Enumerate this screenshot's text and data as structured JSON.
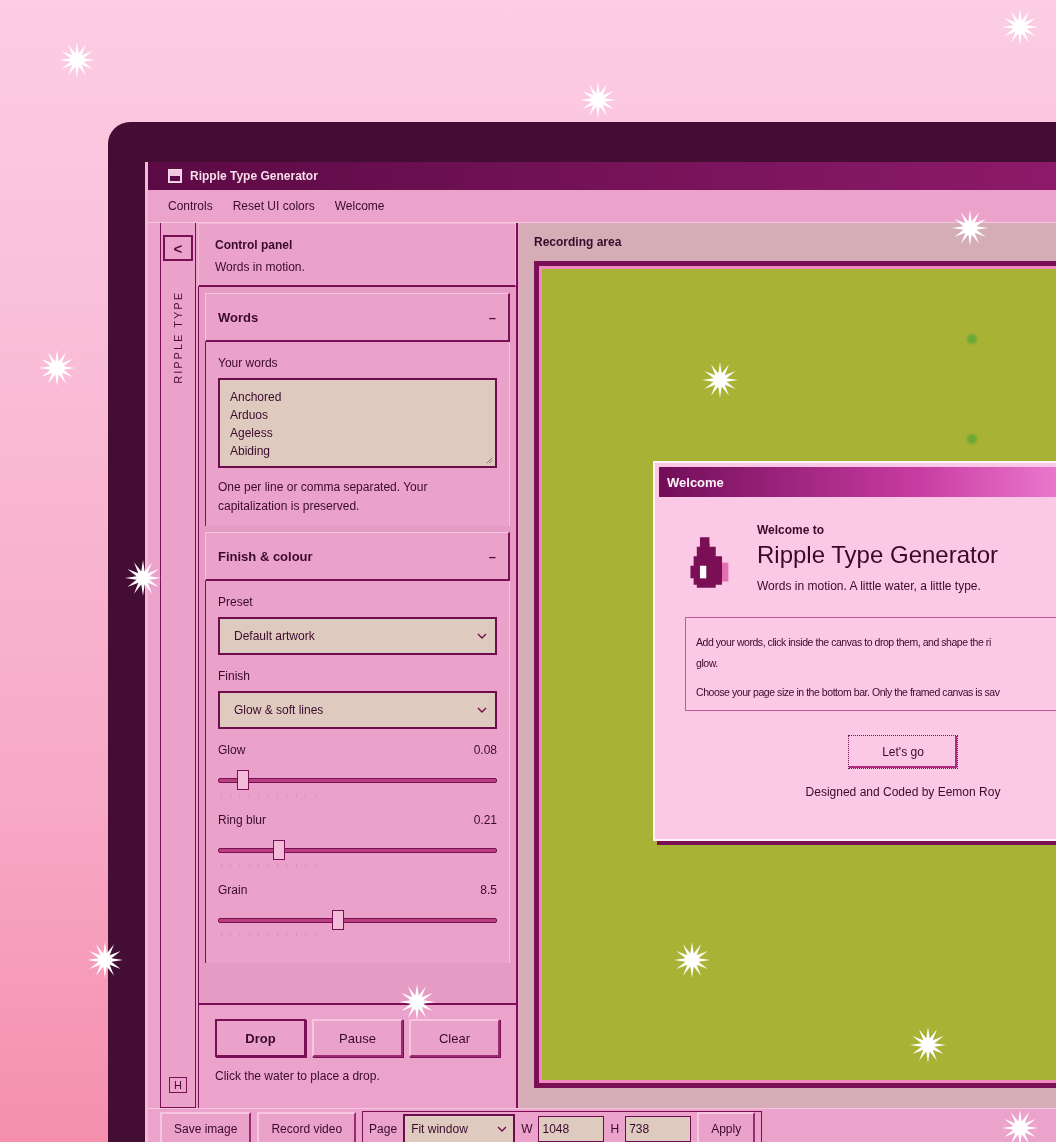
{
  "window": {
    "title": "Ripple Type Generator"
  },
  "menu": [
    {
      "label": "Controls"
    },
    {
      "label": "Reset UI colors"
    },
    {
      "label": "Welcome"
    }
  ],
  "rail": {
    "back": "<",
    "label": "RIPPLE TYPE",
    "bottom": "H"
  },
  "panel": {
    "title": "Control panel",
    "subtitle": "Words in motion."
  },
  "sections": [
    {
      "title": "Words",
      "toggle": "–",
      "expanded": true,
      "fields": [
        {
          "kind": "textarea",
          "label": "Your words",
          "lines": [
            "Anchored",
            "Arduos",
            "Ageless",
            "Abiding"
          ],
          "hint": "One per line or comma separated. Your capitalization is preserved."
        }
      ]
    },
    {
      "title": "Finish & colour",
      "toggle": "–",
      "expanded": true,
      "fields": [
        {
          "kind": "select",
          "label": "Preset",
          "value": "Default artwork"
        },
        {
          "kind": "select",
          "label": "Finish",
          "value": "Glow & soft lines"
        },
        {
          "kind": "slider",
          "label": "Glow",
          "reading": "0.08",
          "level": 0.09
        },
        {
          "kind": "slider",
          "label": "Ring blur",
          "reading": "0.21",
          "level": 0.22
        },
        {
          "kind": "slider",
          "label": "Grain",
          "reading": "8.5",
          "level": 0.43
        }
      ]
    }
  ],
  "actions": [
    {
      "label": "Drop",
      "default": true
    },
    {
      "label": "Pause",
      "default": false
    },
    {
      "label": "Clear",
      "default": false
    }
  ],
  "action_hint": "Click the water to place a drop.",
  "recording": {
    "title": "Recording area"
  },
  "dialog": {
    "title": "Welcome",
    "kicker": "Welcome to",
    "heading": "Ripple Type Generator",
    "tagline": "Words in motion. A little water, a little type.",
    "paragraphs": [
      "Add your words, click inside the canvas to drop them, and shape the ri\nglow.",
      "Choose your page size in the bottom bar. Only the framed canvas is sav"
    ],
    "button": "Let's go",
    "credit": "Designed and Coded by Eemon Roy"
  },
  "bottom_bar": {
    "buttons": [
      "Save image",
      "Record video"
    ],
    "page_label": "Page",
    "page_value": "Fit window",
    "w_label": "W",
    "w_value": "1048",
    "h_label": "H",
    "h_value": "738",
    "apply": "Apply"
  }
}
